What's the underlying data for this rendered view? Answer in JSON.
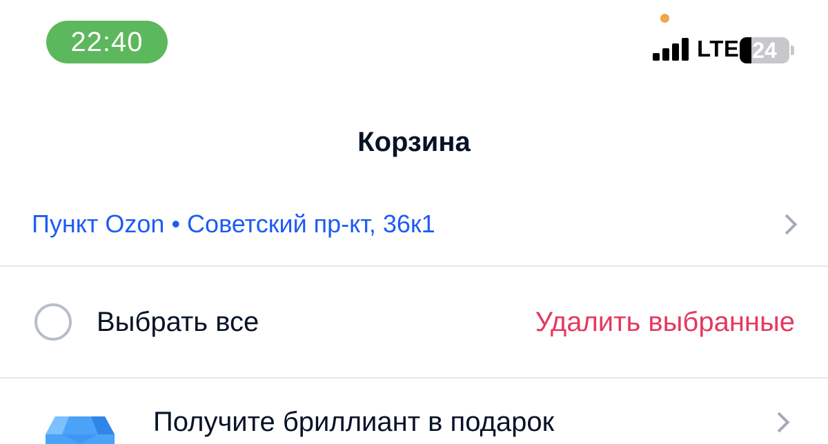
{
  "status_bar": {
    "time": "22:40",
    "network": "LTE",
    "battery_level": "24",
    "battery_fraction": 0.24,
    "signal_bars_filled": 4,
    "signal_bars_total": 4
  },
  "header": {
    "title": "Корзина"
  },
  "delivery": {
    "text": "Пункт Ozon • Советский пр-кт, 36к1",
    "icon": "chevron-right-icon"
  },
  "selection": {
    "select_all_label": "Выбрать все",
    "delete_selected_label": "Удалить выбранные",
    "select_all_checked": false
  },
  "promo": {
    "text": "Получите бриллиант в подарок",
    "icon": "diamond-icon"
  },
  "colors": {
    "accent_blue": "#1d5cf0",
    "delete_red": "#e5385e",
    "time_pill_green": "#5cb85c",
    "indicator_orange": "#f3a54a",
    "text_dark": "#071226",
    "chevron_gray": "#a3abb8",
    "divider_gray": "#e4e7ec"
  }
}
